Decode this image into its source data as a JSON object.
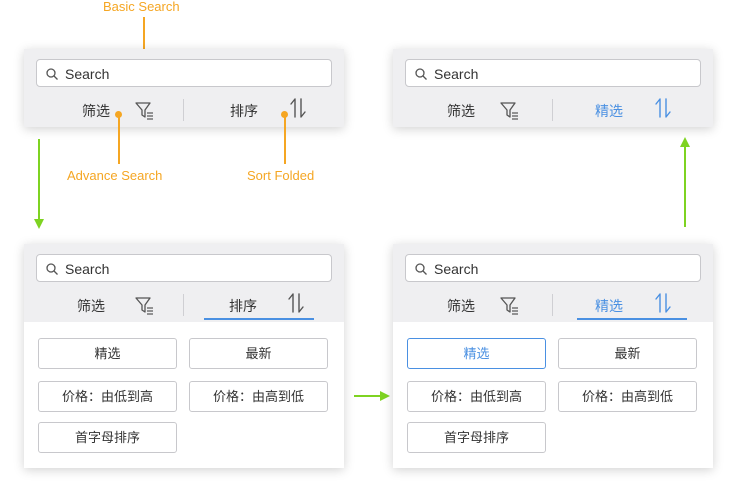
{
  "annotations": {
    "basic_search": "Basic Search",
    "advance_search": "Advance Search",
    "sort_folded": "Sort Folded"
  },
  "search": {
    "placeholder": "Search"
  },
  "tabs": {
    "filter": "筛选",
    "sort": "排序",
    "selected": "精选"
  },
  "options": {
    "selected": "精选",
    "newest": "最新",
    "price_low_high": "价格：由低到高",
    "price_high_low": "价格：由高到低",
    "alpha_sort": "首字母排序"
  },
  "colors": {
    "accent": "#4a90e2",
    "annotation": "#f5a623",
    "arrow": "#7ed321",
    "bar": "#efeff1"
  }
}
